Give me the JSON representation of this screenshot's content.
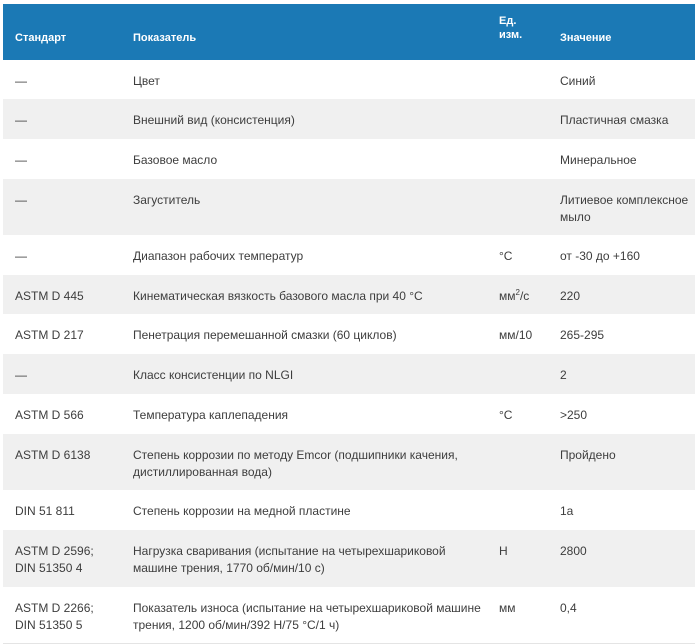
{
  "table": {
    "headers": {
      "standard": "Стандарт",
      "indicator": "Показатель",
      "unit_line1": "Ед.",
      "unit_line2": "изм.",
      "value": "Значение"
    },
    "rows": [
      {
        "standard": "—",
        "indicator": "Цвет",
        "unit": "",
        "value": "Синий"
      },
      {
        "standard": "—",
        "indicator": "Внешний вид (консистенция)",
        "unit": "",
        "value": "Пластичная смазка"
      },
      {
        "standard": "—",
        "indicator": "Базовое масло",
        "unit": "",
        "value": "Минеральное"
      },
      {
        "standard": "—",
        "indicator": "Загуститель",
        "unit": "",
        "value": "Литиевое комплексное мыло"
      },
      {
        "standard": "—",
        "indicator": "Диапазон рабочих температур",
        "unit": "°C",
        "value": "от -30 до +160"
      },
      {
        "standard": "ASTM D 445",
        "indicator": "Кинематическая вязкость базового масла при 40 °C",
        "unit_base": "мм",
        "unit_sup": "2",
        "unit_tail": "/с",
        "value": "220"
      },
      {
        "standard": "ASTM D 217",
        "indicator": "Пенетрация перемешанной смазки (60 циклов)",
        "unit": "мм/10",
        "value": "265-295"
      },
      {
        "standard": "—",
        "indicator": "Класс консистенции по NLGI",
        "unit": "",
        "value": "2"
      },
      {
        "standard": "ASTM D 566",
        "indicator": "Температура каплепадения",
        "unit": "°C",
        "value": ">250"
      },
      {
        "standard": "ASTM D 6138",
        "indicator": "Степень коррозии по методу Emcor (подшипники качения, дистиллированная вода)",
        "unit": "",
        "value": "Пройдено"
      },
      {
        "standard": "DIN 51 811",
        "indicator": "Степень коррозии на медной пластине",
        "unit": "",
        "value": "1а"
      },
      {
        "standard": "ASTM D 2596; DIN 51350 4",
        "indicator": "Нагрузка сваривания (испытание на четырехшариковой машине трения, 1770 об/мин/10 с)",
        "unit": "Н",
        "value": "2800"
      },
      {
        "standard": "ASTM D 2266; DIN 51350 5",
        "indicator": "Показатель износа (испытание на четырехшариковой машине трения, 1200 об/мин/392 Н/75 °С/1 ч)",
        "unit": "мм",
        "value": "0,4"
      }
    ]
  }
}
